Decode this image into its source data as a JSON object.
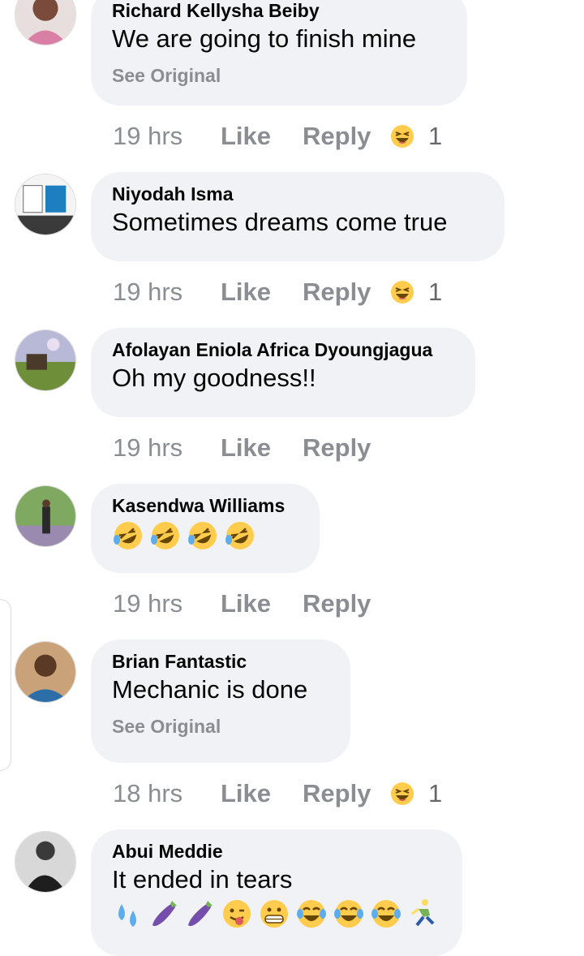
{
  "comments": [
    {
      "author": "Richard Kellysha Beiby",
      "text": "We are going to finish mine",
      "see_original": "See Original",
      "time": "19 hrs",
      "like": "Like",
      "reply": "Reply",
      "reaction": "laughing-squint",
      "reaction_count": "1"
    },
    {
      "author": "Niyodah Isma",
      "text": "Sometimes dreams come true",
      "time": "19 hrs",
      "like": "Like",
      "reply": "Reply",
      "reaction": "laughing-squint",
      "reaction_count": "1"
    },
    {
      "author": "Afolayan Eniola Africa Dyoungjagua",
      "text": "Oh my goodness!!",
      "time": "19 hrs",
      "like": "Like",
      "reply": "Reply"
    },
    {
      "author": "Kasendwa Williams",
      "emojis": [
        "rolling-on-floor-laughing",
        "rolling-on-floor-laughing",
        "rolling-on-floor-laughing",
        "rolling-on-floor-laughing"
      ],
      "time": "19 hrs",
      "like": "Like",
      "reply": "Reply"
    },
    {
      "author": "Brian Fantastic",
      "text": "Mechanic is done",
      "see_original": "See Original",
      "time": "18 hrs",
      "like": "Like",
      "reply": "Reply",
      "reaction": "laughing-squint",
      "reaction_count": "1"
    },
    {
      "author": "Abui Meddie",
      "text": "It ended in tears",
      "emojis": [
        "sweat-droplets",
        "eggplant",
        "eggplant",
        "tongue-wink",
        "grimacing",
        "tears-of-joy",
        "tears-of-joy",
        "tears-of-joy",
        "running-person"
      ]
    }
  ],
  "colors": {
    "bubble": "#f0f2f5",
    "meta_text": "#8a8d91",
    "text": "#050505",
    "emoji_yellow": "#ffcc4d"
  }
}
